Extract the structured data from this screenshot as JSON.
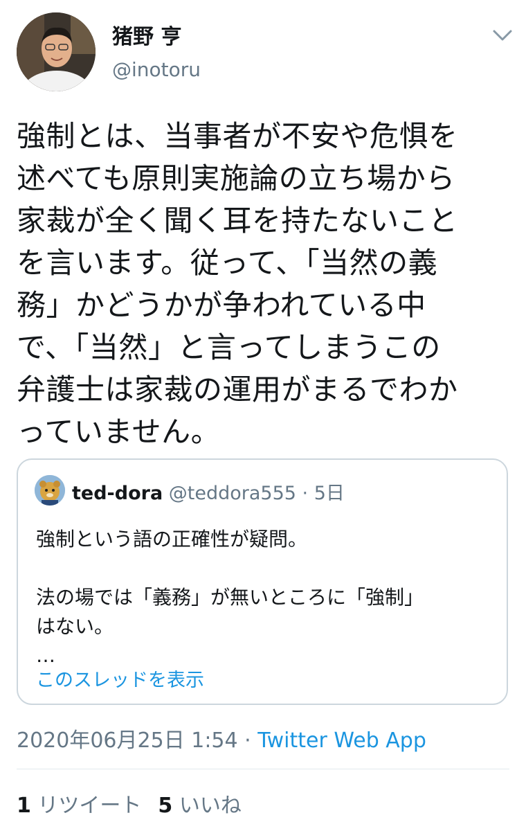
{
  "author": {
    "display_name": "猪野 亨",
    "handle": "@inotoru"
  },
  "tweet": {
    "text": "強制とは、当事者が不安や危惧を\n述べても原則実施論の立ち場から\n家裁が全く聞く耳を持たないこと\nを言います。従って、「当然の義\n務」かどうかが争われている中\nで、「当然」と言ってしまうこの\n弁護士は家裁の運用がまるでわか\nっていません。"
  },
  "quote": {
    "name": "ted-dora",
    "handle": "@teddora555",
    "separator": "·",
    "time": "5日",
    "body": "強制という語の正確性が疑問。\n\n法の場では「義務」が無いところに「強制」\nはない。\n…",
    "thread_link": "このスレッドを表示"
  },
  "meta": {
    "datetime": "2020年06月25日 1:54",
    "separator": "·",
    "source": "Twitter Web App"
  },
  "stats": {
    "retweets_count": "1",
    "retweets_label": "リツイート",
    "likes_count": "5",
    "likes_label": "いいね"
  },
  "icons": {
    "caret": "chevron-down-icon"
  },
  "colors": {
    "text": "#14171a",
    "secondary": "#657786",
    "link": "#1b95e0",
    "border": "#ccd6dd"
  }
}
